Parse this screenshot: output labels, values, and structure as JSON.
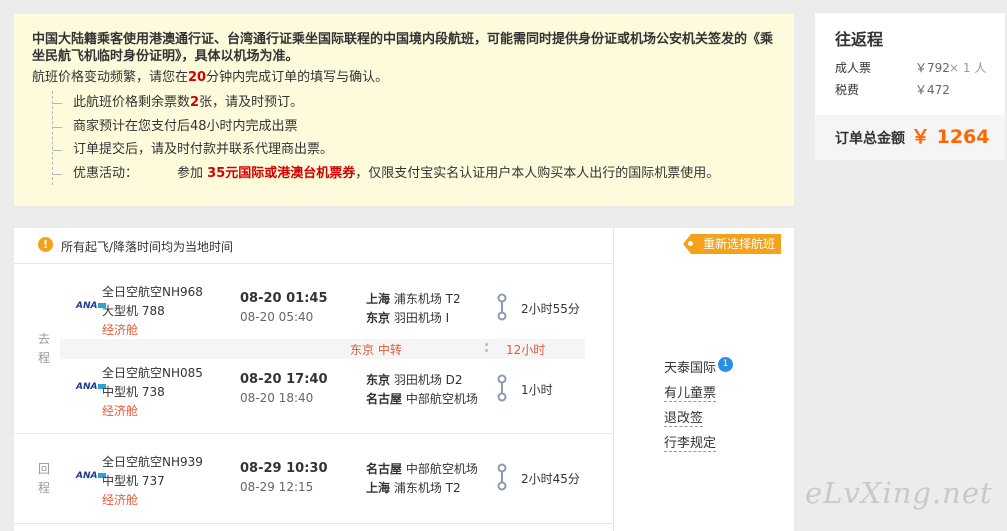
{
  "notice": {
    "lead": "中国大陆籍乘客使用港澳通行证、台湾通行证乘坐国际联程的中国境内段航班，可能需同时提供身份证或机场公安机关签发的《乘坐民航飞机临时身份证明》，具体以机场为准。",
    "price_note_pre": "航班价格变动频繁，请您在",
    "price_note_minutes": "20",
    "price_note_post": "分钟内完成订单的填写与确认。",
    "items": [
      {
        "pre": "此航班价格剩余票数",
        "num": "2",
        "post": "张，请及时预订。"
      },
      {
        "text": "商家预计在您支付后48小时内完成出票"
      },
      {
        "text": "订单提交后，请及时付款并联系代理商出票。"
      }
    ],
    "promo": {
      "label": "优惠活动：",
      "pre": "参加",
      "tag": "35元国际或港澳台机票券",
      "post": "，仅限支付宝实名认证用户本人购买本人出行的国际机票使用。"
    }
  },
  "summary": {
    "title": "往返程",
    "adult_label": "成人票",
    "adult_amount": "￥792",
    "adult_qty": "× 1 人",
    "tax_label": "税费",
    "tax_amount": "￥472",
    "total_label": "订单总金额",
    "total_value": "￥ 1264"
  },
  "flights": {
    "header_text": "所有起飞/降落时间均为当地时间",
    "reselect_label": "重新选择航班",
    "outbound_label": [
      "去",
      "程"
    ],
    "return_label": [
      "回",
      "程"
    ],
    "legs": [
      {
        "airline": "全日空航空NH968",
        "aircraft": "大型机 788",
        "cabin": "经济舱",
        "dep_time": "08-20 01:45",
        "arr_time": "08-20 05:40",
        "from_city": "上海",
        "from_airport": "浦东机场 T2",
        "to_city": "东京",
        "to_airport": "羽田机场 I",
        "duration": "2小时55分"
      },
      {
        "airline": "全日空航空NH085",
        "aircraft": "中型机 738",
        "cabin": "经济舱",
        "dep_time": "08-20 17:40",
        "arr_time": "08-20 18:40",
        "from_city": "东京",
        "from_airport": "羽田机场 D2",
        "to_city": "名古屋",
        "to_airport": "中部航空机场",
        "duration": "1小时"
      },
      {
        "airline": "全日空航空NH939",
        "aircraft": "中型机 737",
        "cabin": "经济舱",
        "dep_time": "08-29 10:30",
        "arr_time": "08-29 12:15",
        "from_city": "名古屋",
        "from_airport": "中部航空机场",
        "to_city": "上海",
        "to_airport": "浦东机场 T2",
        "duration": "2小时45分"
      }
    ],
    "transfer": {
      "city": "东京 中转",
      "time": "12小时"
    },
    "logo_text": "ANA"
  },
  "agent": {
    "name": "天泰国际",
    "badge": "1",
    "links": [
      "有儿童票",
      "退改签",
      "行李规定"
    ]
  },
  "watermark": "eLvXing.net",
  "colors": {
    "accent": "#f4a21a",
    "price": "#ff6600",
    "red": "#d40000",
    "cabin": "#e45b3b",
    "notice_bg": "#fdfbdc"
  }
}
